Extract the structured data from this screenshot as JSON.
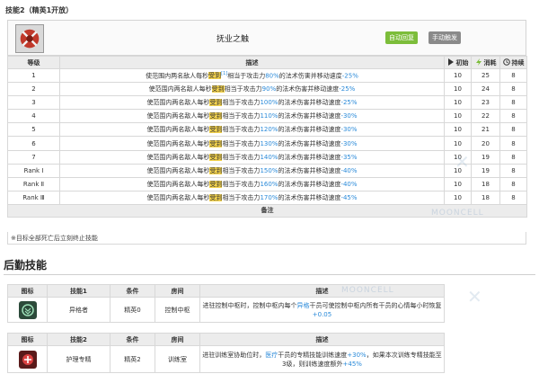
{
  "section_title": "技能2（精英1开放）",
  "skill": {
    "name": "抚业之触",
    "tag_recovery": "自动回复",
    "tag_trigger": "手动触发"
  },
  "table": {
    "headers": {
      "level": "等级",
      "desc": "描述",
      "init": "初始",
      "cost": "消耗",
      "duration": "持续"
    },
    "desc_prefix": "使范围内两名敌人每秒",
    "desc_keyword": "受到",
    "desc_sup": "[1]",
    "desc_mid": "相当于攻击力",
    "desc_mid2": "的法术伤害并移动速度",
    "rows": [
      {
        "level": "1",
        "atk": "80%",
        "spd": "-25%",
        "init": "10",
        "cost": "25",
        "dur": "8"
      },
      {
        "level": "2",
        "atk": "90%",
        "spd": "-25%",
        "init": "10",
        "cost": "24",
        "dur": "8"
      },
      {
        "level": "3",
        "atk": "100%",
        "spd": "-25%",
        "init": "10",
        "cost": "23",
        "dur": "8"
      },
      {
        "level": "4",
        "atk": "110%",
        "spd": "-30%",
        "init": "10",
        "cost": "22",
        "dur": "8"
      },
      {
        "level": "5",
        "atk": "120%",
        "spd": "-30%",
        "init": "10",
        "cost": "21",
        "dur": "8"
      },
      {
        "level": "6",
        "atk": "130%",
        "spd": "-30%",
        "init": "10",
        "cost": "20",
        "dur": "8"
      },
      {
        "level": "7",
        "atk": "140%",
        "spd": "-35%",
        "init": "10",
        "cost": "19",
        "dur": "8"
      },
      {
        "level": "Rank Ⅰ",
        "atk": "150%",
        "spd": "-40%",
        "init": "10",
        "cost": "19",
        "dur": "8"
      },
      {
        "level": "Rank Ⅱ",
        "atk": "160%",
        "spd": "-40%",
        "init": "10",
        "cost": "18",
        "dur": "8"
      },
      {
        "level": "Rank Ⅲ",
        "atk": "170%",
        "spd": "-45%",
        "init": "10",
        "cost": "18",
        "dur": "8"
      }
    ],
    "note_header": "备注",
    "note_text": "※目标全部死亡后立刻终止技能"
  },
  "base": {
    "section": "后勤技能",
    "headers": {
      "icon": "图标",
      "skill1": "技能1",
      "skill2": "技能2",
      "cond": "条件",
      "room": "房间",
      "desc": "描述"
    },
    "skill1": {
      "name": "异格者",
      "cond": "精英0",
      "room": "控制中枢",
      "desc_a": "进驻控制中枢时，控制中枢内每个",
      "desc_link": "异格",
      "desc_b": "干员可使控制中枢内所有干员的心情每小时恢复",
      "desc_num": "+0.05"
    },
    "skill2": {
      "name": "护理专精",
      "cond": "精英2",
      "room": "训练室",
      "desc_a": "进驻训练室协助位时，",
      "desc_link": "医疗",
      "desc_b": "干员的专精技能训练速度",
      "desc_num1": "+30%",
      "desc_c": "，如果本次训练专精技能至3级，则训练速度额外",
      "desc_num2": "+45%"
    }
  },
  "watermark": "MOONCELL",
  "colors": {
    "tag_green": "#7cbd3a",
    "tag_gray": "#8a8a8a",
    "highlight": "#f4d34d",
    "number_blue": "#2a8ad9"
  }
}
